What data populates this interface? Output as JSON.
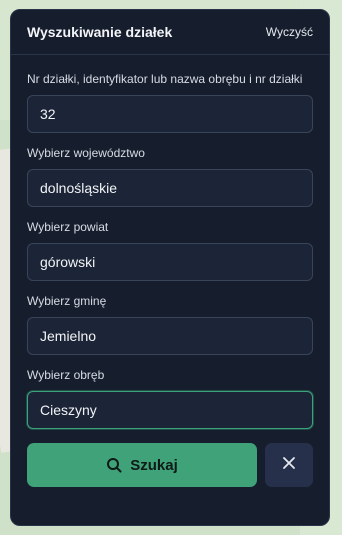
{
  "panel": {
    "title": "Wyszukiwanie działek",
    "clear_label": "Wyczyść"
  },
  "fields": [
    {
      "label": "Nr działki, identyfikator lub nazwa obrębu i nr działki",
      "value": "32"
    },
    {
      "label": "Wybierz województwo",
      "value": "dolnośląskie"
    },
    {
      "label": "Wybierz powiat",
      "value": "górowski"
    },
    {
      "label": "Wybierz gminę",
      "value": "Jemielno"
    },
    {
      "label": "Wybierz obręb",
      "value": "Cieszyny"
    }
  ],
  "actions": {
    "search_label": "Szukaj",
    "search_icon": "search-icon",
    "close_icon": "close-icon"
  },
  "colors": {
    "panel_bg": "#161e2e",
    "accent": "#3fa278"
  }
}
